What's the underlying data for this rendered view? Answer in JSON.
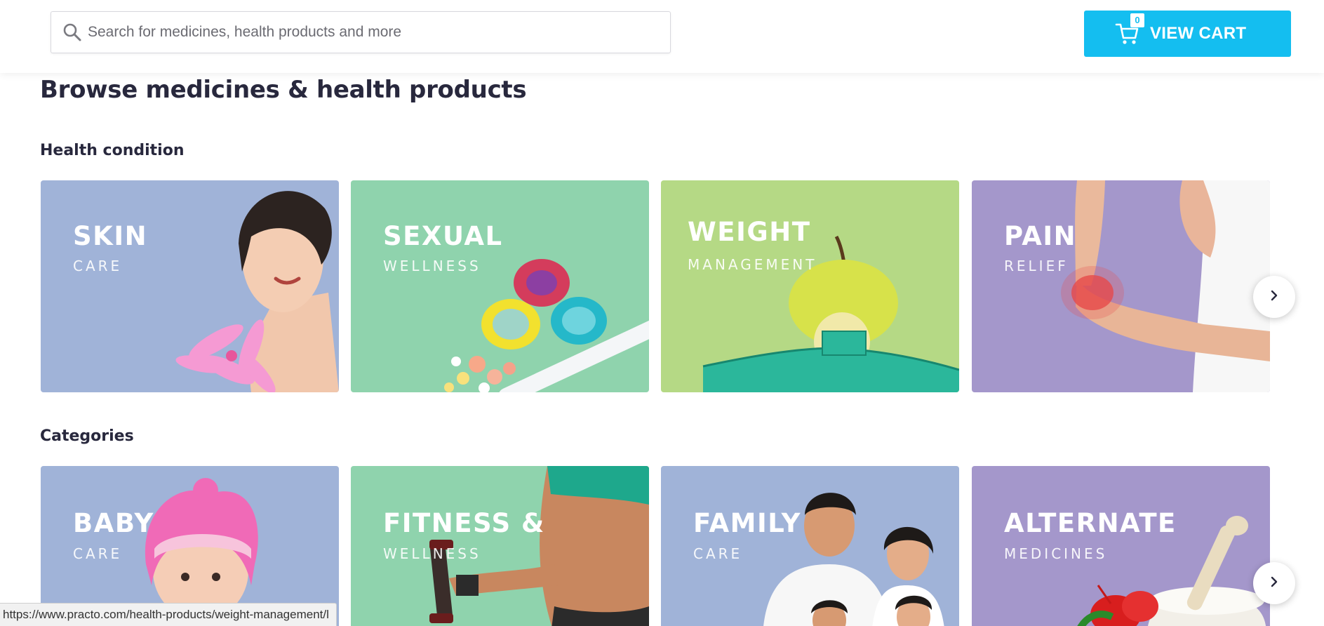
{
  "search": {
    "placeholder": "Search for medicines, health products and more"
  },
  "cart": {
    "label": "VIEW CART",
    "count": "0",
    "color": "#14bef0"
  },
  "page_title": "Browse medicines & health products",
  "sections": {
    "health_condition": {
      "title": "Health condition",
      "cards": [
        {
          "title": "SKIN",
          "subtitle": "CARE",
          "bg": "#a0b3d8"
        },
        {
          "title": "SEXUAL",
          "subtitle": "WELLNESS",
          "bg": "#8fd3ad"
        },
        {
          "title": "WEIGHT",
          "subtitle": "MANAGEMENT",
          "bg": "#b5d985"
        },
        {
          "title": "PAIN",
          "subtitle": "RELIEF",
          "bg": "#a497cb"
        }
      ]
    },
    "categories": {
      "title": "Categories",
      "cards": [
        {
          "title": "BABY",
          "subtitle": "CARE",
          "bg": "#a0b3d8"
        },
        {
          "title": "FITNESS &",
          "subtitle": "WELLNESS",
          "bg": "#8fd3ad"
        },
        {
          "title": "FAMILY",
          "subtitle": "CARE",
          "bg": "#a0b3d8"
        },
        {
          "title": "ALTERNATE",
          "subtitle": "MEDICINES",
          "bg": "#a497cb"
        }
      ]
    }
  },
  "status_bar": {
    "url": "https://www.practo.com/health-products/weight-management/l"
  },
  "icons": {
    "search": "search-icon",
    "cart": "cart-icon",
    "next": "chevron-right-icon"
  }
}
